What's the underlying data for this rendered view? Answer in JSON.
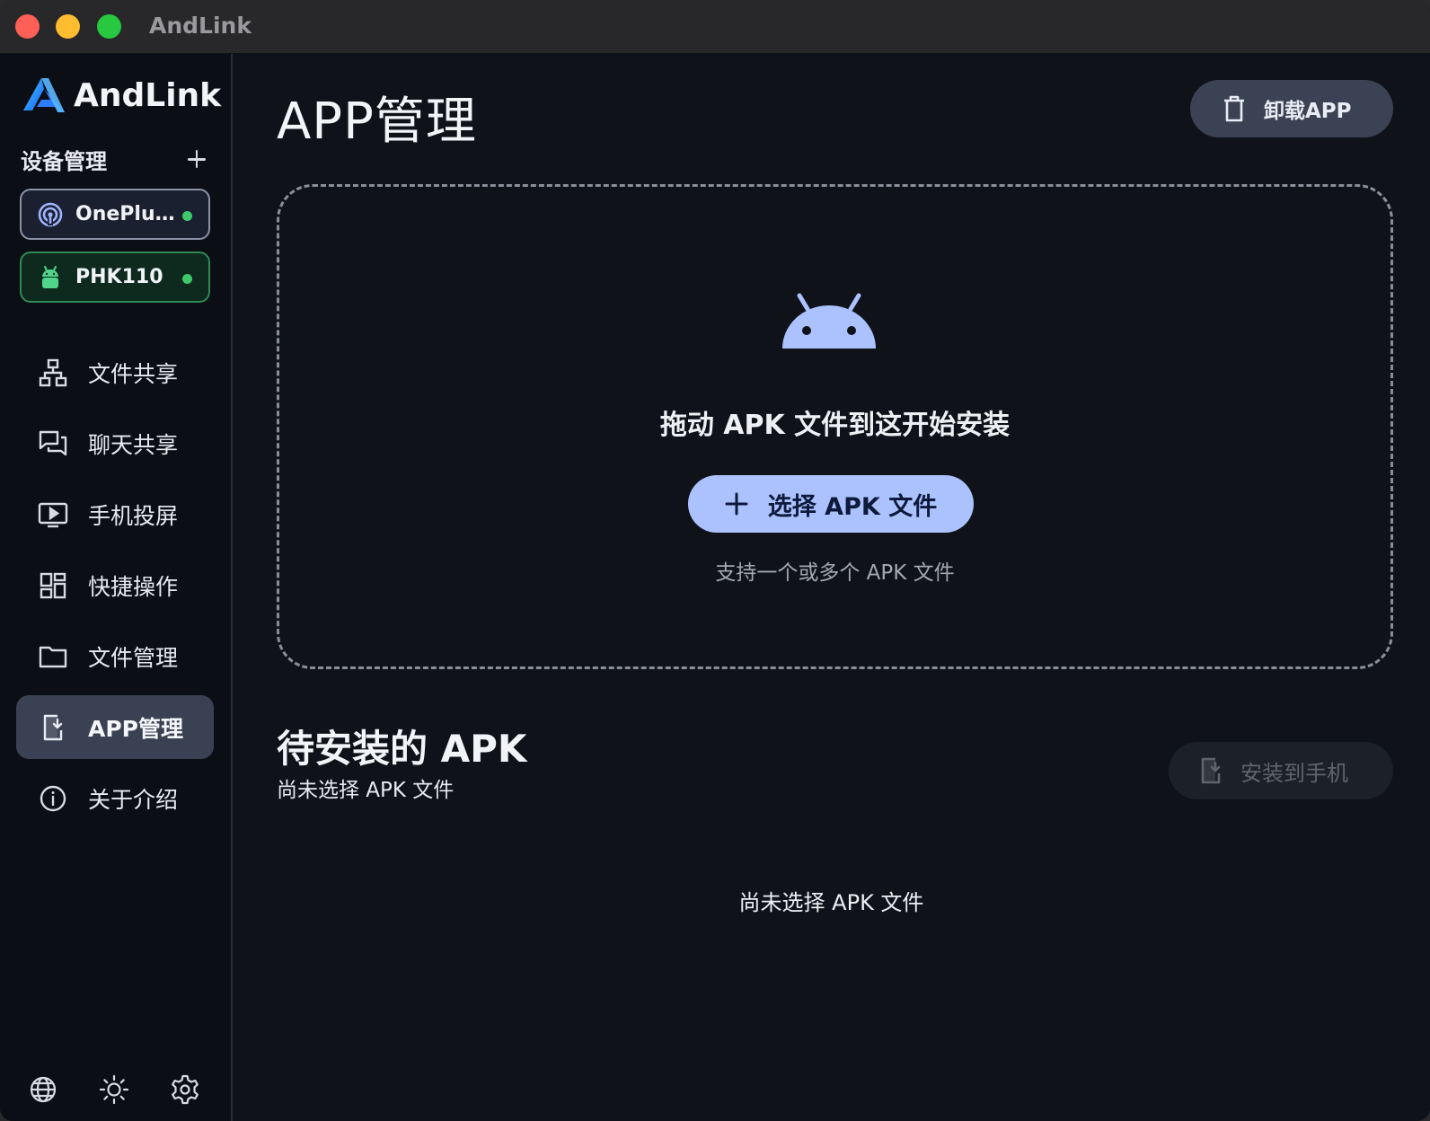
{
  "window": {
    "title": "AndLink"
  },
  "sidebar": {
    "brand": "AndLink",
    "devices_header": "设备管理",
    "devices": [
      {
        "name": "OnePlus...",
        "icon": "wifi-device-icon",
        "status": "online"
      },
      {
        "name": "PHK110",
        "icon": "android-icon",
        "status": "online"
      }
    ],
    "nav": [
      {
        "label": "文件共享",
        "icon": "sitemap-icon"
      },
      {
        "label": "聊天共享",
        "icon": "chat-icon"
      },
      {
        "label": "手机投屏",
        "icon": "screen-cast-icon"
      },
      {
        "label": "快捷操作",
        "icon": "dashboard-icon"
      },
      {
        "label": "文件管理",
        "icon": "folder-icon"
      },
      {
        "label": "APP管理",
        "icon": "app-install-icon",
        "active": true
      },
      {
        "label": "关于介绍",
        "icon": "info-icon"
      }
    ],
    "bottom": [
      "globe-icon",
      "brightness-icon",
      "settings-icon"
    ]
  },
  "main": {
    "title": "APP管理",
    "uninstall_label": "卸载APP",
    "dropzone": {
      "title": "拖动 APK 文件到这开始安装",
      "select_label": "选择 APK 文件",
      "hint": "支持一个或多个 APK 文件"
    },
    "pending": {
      "title": "待安装的 APK",
      "subtitle": "尚未选择 APK 文件",
      "install_label": "安装到手机",
      "empty_text": "尚未选择 APK 文件"
    }
  },
  "colors": {
    "accent": "#abc2ff",
    "background": "#0f1218",
    "sidebar": "#0b0e14",
    "active_nav": "#3a4152",
    "online": "#3ec86a"
  }
}
